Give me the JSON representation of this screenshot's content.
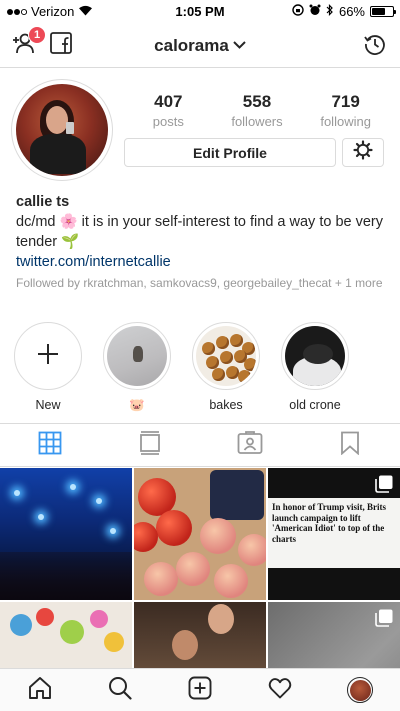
{
  "status_bar": {
    "carrier": "Verizon",
    "time": "1:05 PM",
    "battery": "66%",
    "battery_level": 0.66
  },
  "header": {
    "username": "calorama",
    "notification_count": "1",
    "icons": [
      "add-person-icon",
      "facebook-icon",
      "chevron-down-icon",
      "history-icon"
    ]
  },
  "profile": {
    "stats": [
      {
        "value": "407",
        "label": "posts"
      },
      {
        "value": "558",
        "label": "followers"
      },
      {
        "value": "719",
        "label": "following"
      }
    ],
    "edit_label": "Edit Profile",
    "name": "callie ts",
    "bio": "dc/md 🌸 it is in your self-interest to find a way to be very tender 🌱",
    "link": "twitter.com/internetcallie",
    "followed_by": "Followed by rkratchman, samkovacs9, georgebailey_thecat + 1 more"
  },
  "highlights": [
    {
      "label": "New"
    },
    {
      "label": "🐷"
    },
    {
      "label": "bakes"
    },
    {
      "label": "old crone"
    }
  ],
  "grid": {
    "headline": "In honor of Trump visit, Brits launch campaign to lift 'American Idiot' to top of the charts"
  },
  "colors": {
    "accent": "#3897f0",
    "badge": "#ed4956",
    "text": "#262626",
    "muted": "#999999",
    "link": "#003569",
    "border": "#dbdbdb"
  },
  "tabs": [
    "grid-icon",
    "feed-list-icon",
    "tagged-icon",
    "saved-icon"
  ],
  "bottom_nav": [
    "home-icon",
    "search-icon",
    "new-post-icon",
    "activity-icon",
    "profile-icon"
  ]
}
